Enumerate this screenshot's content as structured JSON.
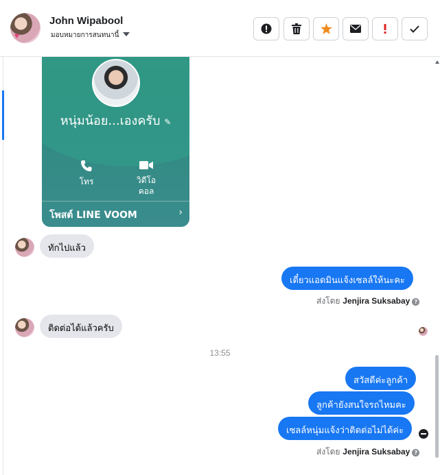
{
  "header": {
    "contact_name": "John Wipabool",
    "assign_label": "มอบหมายการสนทนานี้",
    "actions": [
      {
        "name": "report-icon",
        "color": "#1c1e21"
      },
      {
        "name": "trash-icon",
        "color": "#1c1e21"
      },
      {
        "name": "star-icon",
        "color": "#f28b1e"
      },
      {
        "name": "mail-icon",
        "color": "#1c1e21"
      },
      {
        "name": "important-icon",
        "color": "#e02424"
      },
      {
        "name": "check-icon",
        "color": "#1c1e21"
      }
    ]
  },
  "line_card": {
    "profile_name": "หนุ่มน้อย...เองครับ",
    "call_label": "โทร",
    "video_label_line1": "วิดีโอ",
    "video_label_line2": "คอล",
    "footer_label": "โพสต์ LINE VOOM",
    "footer_chevron": "›"
  },
  "messages": {
    "in_1": "ทักไปแล้ว",
    "out_1": "เดี๋ยวแอดมินแจ้งเซลล์ให้นะคะ",
    "sent_by_prefix": "ส่งโดย",
    "agent_name": "Jenjira Suksabay",
    "in_2": "ติดต่อได้แล้วครับ",
    "time_separator": "13:55",
    "out_2": "สวัสดีค่ะลูกค้า",
    "out_3": "ลูกค้ายังสนใจรถไหมคะ",
    "out_4": "เซลล์หนุ่มแจ้งว่าติดต่อไม่ได้ค่ะ",
    "help_mark": "?"
  },
  "colors": {
    "outgoing_bubble": "#1877f2",
    "incoming_bubble": "#e4e6eb",
    "card_teal": "#318a80"
  }
}
